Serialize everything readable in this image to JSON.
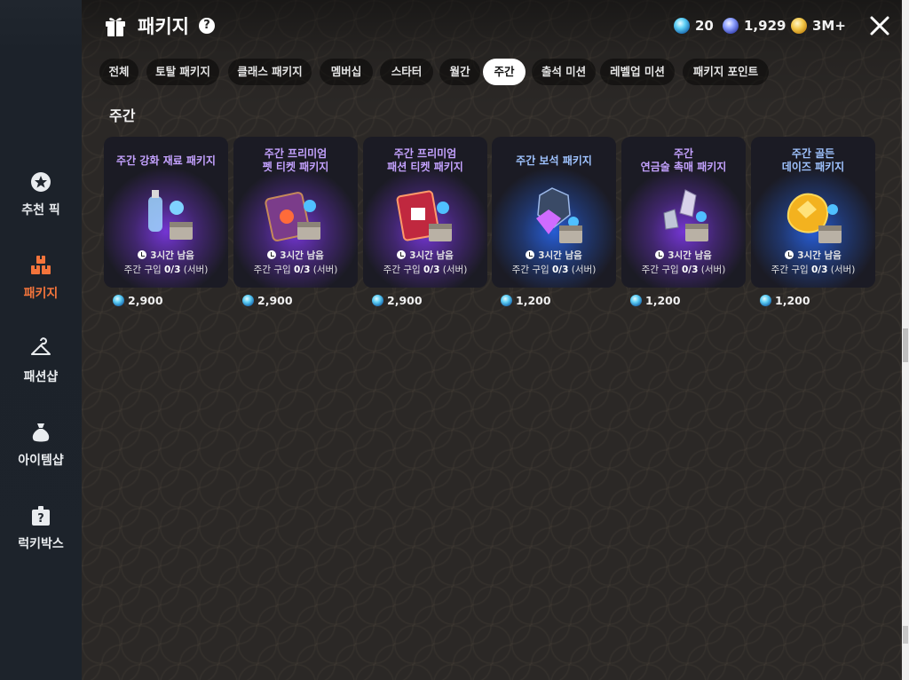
{
  "header": {
    "title": "패키지",
    "help_icon": "?",
    "currencies": [
      {
        "name": "blue-gem",
        "value": "20"
      },
      {
        "name": "purple-gem",
        "value": "1,929"
      },
      {
        "name": "gold-coin",
        "value": "3M+"
      }
    ]
  },
  "sidebar": {
    "items": [
      {
        "label": "추천 픽",
        "icon": "star-badge-icon"
      },
      {
        "label": "패키지",
        "icon": "boxes-icon",
        "active": true
      },
      {
        "label": "패션샵",
        "icon": "hanger-icon"
      },
      {
        "label": "아이템샵",
        "icon": "money-bag-icon"
      },
      {
        "label": "럭키박스",
        "icon": "mystery-box-icon"
      }
    ]
  },
  "tabs": [
    {
      "label": "전체"
    },
    {
      "label": "토탈 패키지"
    },
    {
      "label": "클래스 패키지"
    },
    {
      "label": "멤버십"
    },
    {
      "label": "스타터"
    },
    {
      "label": "월간"
    },
    {
      "label": "주간",
      "active": true
    },
    {
      "label": "출석 미션"
    },
    {
      "label": "레벨업 미션"
    },
    {
      "label": "패키지 포인트"
    }
  ],
  "section": {
    "title": "주간"
  },
  "cards": [
    {
      "name_line1": "주간 강화 재료 패키지",
      "name_line2": "",
      "timer": "3시간 남음",
      "limit_prefix": "주간 구입",
      "limit_value": "0/3",
      "limit_suffix": "(서버)",
      "price": "2,900",
      "name_color": "#c4a2ff",
      "glow": "#8a3cff"
    },
    {
      "name_line1": "주간 프리미엄",
      "name_line2": "펫 티켓 패키지",
      "timer": "3시간 남음",
      "limit_prefix": "주간 구입",
      "limit_value": "0/3",
      "limit_suffix": "(서버)",
      "price": "2,900",
      "name_color": "#c4a2ff",
      "glow": "#8a3cff"
    },
    {
      "name_line1": "주간 프리미엄",
      "name_line2": "패션 티켓 패키지",
      "timer": "3시간 남음",
      "limit_prefix": "주간 구입",
      "limit_value": "0/3",
      "limit_suffix": "(서버)",
      "price": "2,900",
      "name_color": "#c4a2ff",
      "glow": "#8a3cff"
    },
    {
      "name_line1": "주간 보석 패키지",
      "name_line2": "",
      "timer": "3시간 남음",
      "limit_prefix": "주간 구입",
      "limit_value": "0/3",
      "limit_suffix": "(서버)",
      "price": "1,200",
      "name_color": "#9fc3ff",
      "glow": "#2a6dff"
    },
    {
      "name_line1": "주간",
      "name_line2": "연금술 촉매 패키지",
      "timer": "3시간 남음",
      "limit_prefix": "주간 구입",
      "limit_value": "0/3",
      "limit_suffix": "(서버)",
      "price": "1,200",
      "name_color": "#c4a2ff",
      "glow": "#8a3cff"
    },
    {
      "name_line1": "주간 골든",
      "name_line2": "데이즈 패키지",
      "timer": "3시간 남음",
      "limit_prefix": "주간 구입",
      "limit_value": "0/3",
      "limit_suffix": "(서버)",
      "price": "1,200",
      "name_color": "#9fc3ff",
      "glow": "#2a6dff"
    }
  ]
}
